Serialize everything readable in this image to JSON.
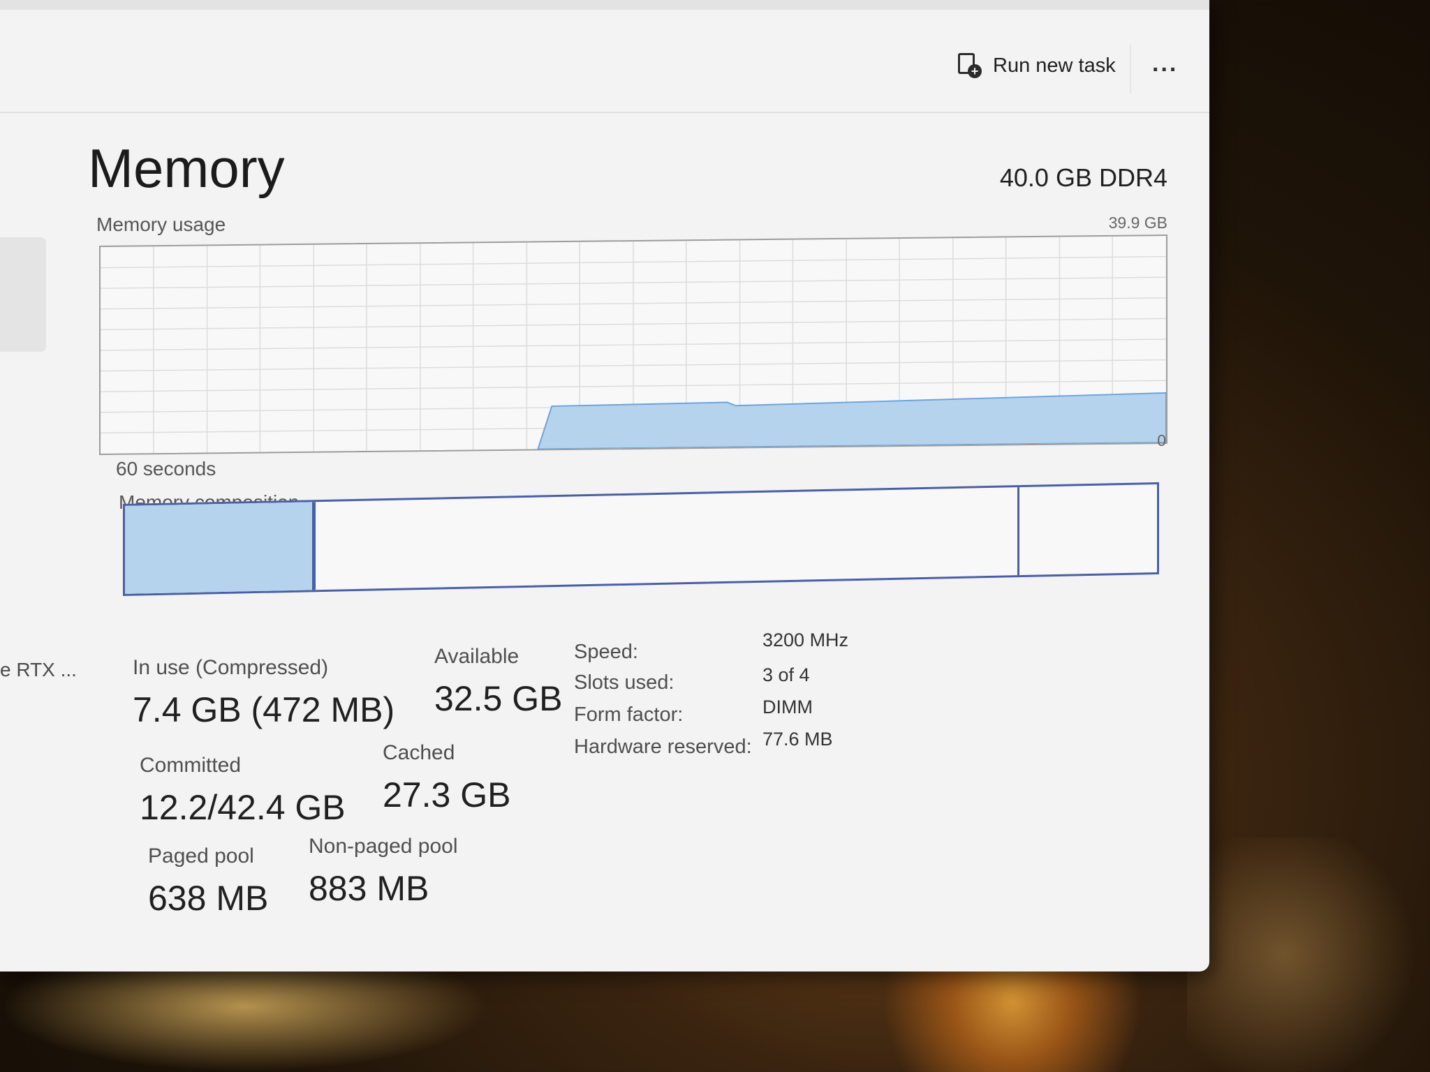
{
  "toolbar": {
    "run_new_task_label": "Run new task",
    "more_label": "..."
  },
  "sidebar": {
    "gpu_item_label": "e RTX ..."
  },
  "header": {
    "title": "Memory",
    "spec": "40.0 GB DDR4"
  },
  "usage_chart": {
    "label": "Memory usage",
    "max_label": "39.9 GB",
    "min_label": "0",
    "time_label": "60 seconds",
    "fill_color": "#b6d3ee",
    "line_color": "#4b8fd6"
  },
  "composition": {
    "label": "Memory composition",
    "segments": [
      {
        "name": "in-use",
        "fraction": 0.185
      },
      {
        "name": "modified",
        "fraction": 0.0
      },
      {
        "name": "standby",
        "fraction": 0.682
      },
      {
        "name": "free",
        "fraction": 0.133
      }
    ],
    "border_color": "#4b5fa6"
  },
  "stats": {
    "in_use_label": "In use (Compressed)",
    "in_use_value": "7.4 GB (472 MB)",
    "available_label": "Available",
    "available_value": "32.5 GB",
    "committed_label": "Committed",
    "committed_value": "12.2/42.4 GB",
    "cached_label": "Cached",
    "cached_value": "27.3 GB",
    "paged_pool_label": "Paged pool",
    "paged_pool_value": "638 MB",
    "nonpaged_pool_label": "Non-paged pool",
    "nonpaged_pool_value": "883 MB"
  },
  "info": {
    "speed_label": "Speed:",
    "speed_value": "3200 MHz",
    "slots_label": "Slots used:",
    "slots_value": "3 of 4",
    "form_factor_label": "Form factor:",
    "form_factor_value": "DIMM",
    "hw_reserved_label": "Hardware reserved:",
    "hw_reserved_value": "77.6 MB"
  }
}
